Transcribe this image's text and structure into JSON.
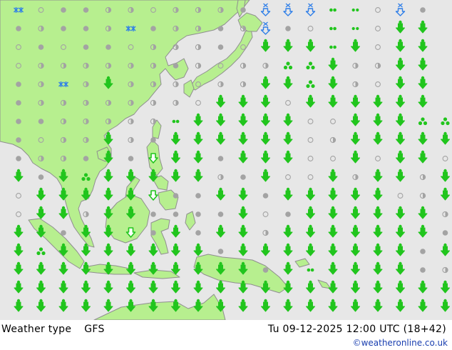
{
  "map": {
    "colors": {
      "sea": "#e7e7e7",
      "land": "#b7ef8f",
      "coast": "#8f8f8f",
      "cloud_gray": "#a3a3a3",
      "rain_green": "#21c51d",
      "snow_blue": "#2f7fe8"
    },
    "grid": {
      "rows": 17,
      "cols": 20
    },
    "legend_symbols": {
      "o": "clear-open-circle",
      "d": "cloudy-filled-dot",
      "h": "partly-cloudy-half-circle",
      "R": "rain-arrow",
      "D": "drizzle-arrow",
      "T": "showers-cluster",
      "S": "snow-flake-pair",
      "B": "snow-arrow",
      "W": "wind-dots",
      "G": "green-pair-dots"
    },
    "cells": [
      "SoddhhohhhdBBBGWoBd ",
      "dhddhSdhhdhBdoGWoRR ",
      "ododdohhhdoRRRGRoRR ",
      "ohhhhhhdhohhTTRhhRR ",
      "dhShRhhhohhRRTRhoRR ",
      "dhhhhhhhoRRRoRRRRRR ",
      "ddhhhhhGRRRRRooRRRTT",
      "dohhRhdRRRRRRohRRRRR",
      "dhhdRdDRRdRRRooRoRRo",
      "RdRTRRRRRhdRooRhRRhR",
      "oRRRRRDddRRdRRRRRohR",
      "oRRhRRddddRodRRRRRRh",
      "RRdRRDdRdRRhRRRRRRRd",
      "RTRRRRRRRdRRRRRRRRdR",
      "RRRRRRRRRRRdRGRRRRdh",
      "RRRRRRRRRRRRRRRRRRRR",
      "RRRRRRRRRRRRRRRRRRRR"
    ]
  },
  "footer": {
    "title": "Weather type",
    "model": "GFS",
    "valid_time": "Tu 09-12-2025 12:00 UTC (18+42)",
    "credit": "©weatheronline.co.uk"
  }
}
